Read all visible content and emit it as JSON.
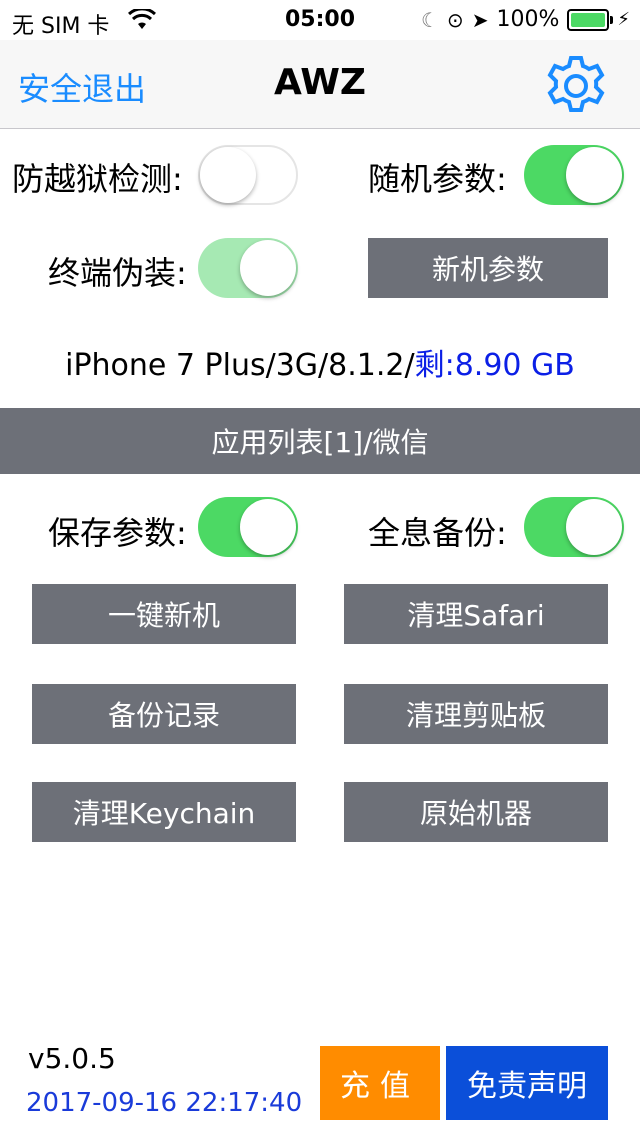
{
  "status_bar": {
    "carrier": "无 SIM 卡",
    "time": "05:00",
    "battery": "100%",
    "icons": [
      "wifi-icon",
      "moon-icon",
      "rotation-lock-icon",
      "location-arrow-icon",
      "battery-icon",
      "charging-bolt-icon"
    ]
  },
  "nav": {
    "left_label": "安全退出",
    "title": "AWZ",
    "settings_icon": "gear-icon",
    "accent": "#1a8cff"
  },
  "toggles": {
    "anti_jailbreak": {
      "label": "防越狱检测:",
      "on": false
    },
    "random_params": {
      "label": "随机参数:",
      "on": true
    },
    "terminal_disguise": {
      "label": "终端伪装:",
      "on": true
    },
    "save_params": {
      "label": "保存参数:",
      "on": true
    },
    "full_backup": {
      "label": "全息备份:",
      "on": true
    }
  },
  "buttons": {
    "new_device_params": "新机参数",
    "one_key_new": "一键新机",
    "clean_safari": "清理Safari",
    "backup_records": "备份记录",
    "clean_clipboard": "清理剪贴板",
    "clean_keychain": "清理Keychain",
    "original_device": "原始机器",
    "recharge": "充值",
    "disclaimer": "免责声明"
  },
  "device_info": {
    "text": "iPhone 7 Plus/3G/8.1.2/",
    "remaining": "剩:8.90 GB"
  },
  "app_list_banner": "应用列表[1]/微信",
  "footer": {
    "version": "v5.0.5",
    "timestamp": "2017-09-16 22:17:40"
  },
  "colors": {
    "switch_on": "#4cd964",
    "button_gray": "#6d7078",
    "orange": "#ff8c00",
    "blue": "#0b4fd9"
  }
}
